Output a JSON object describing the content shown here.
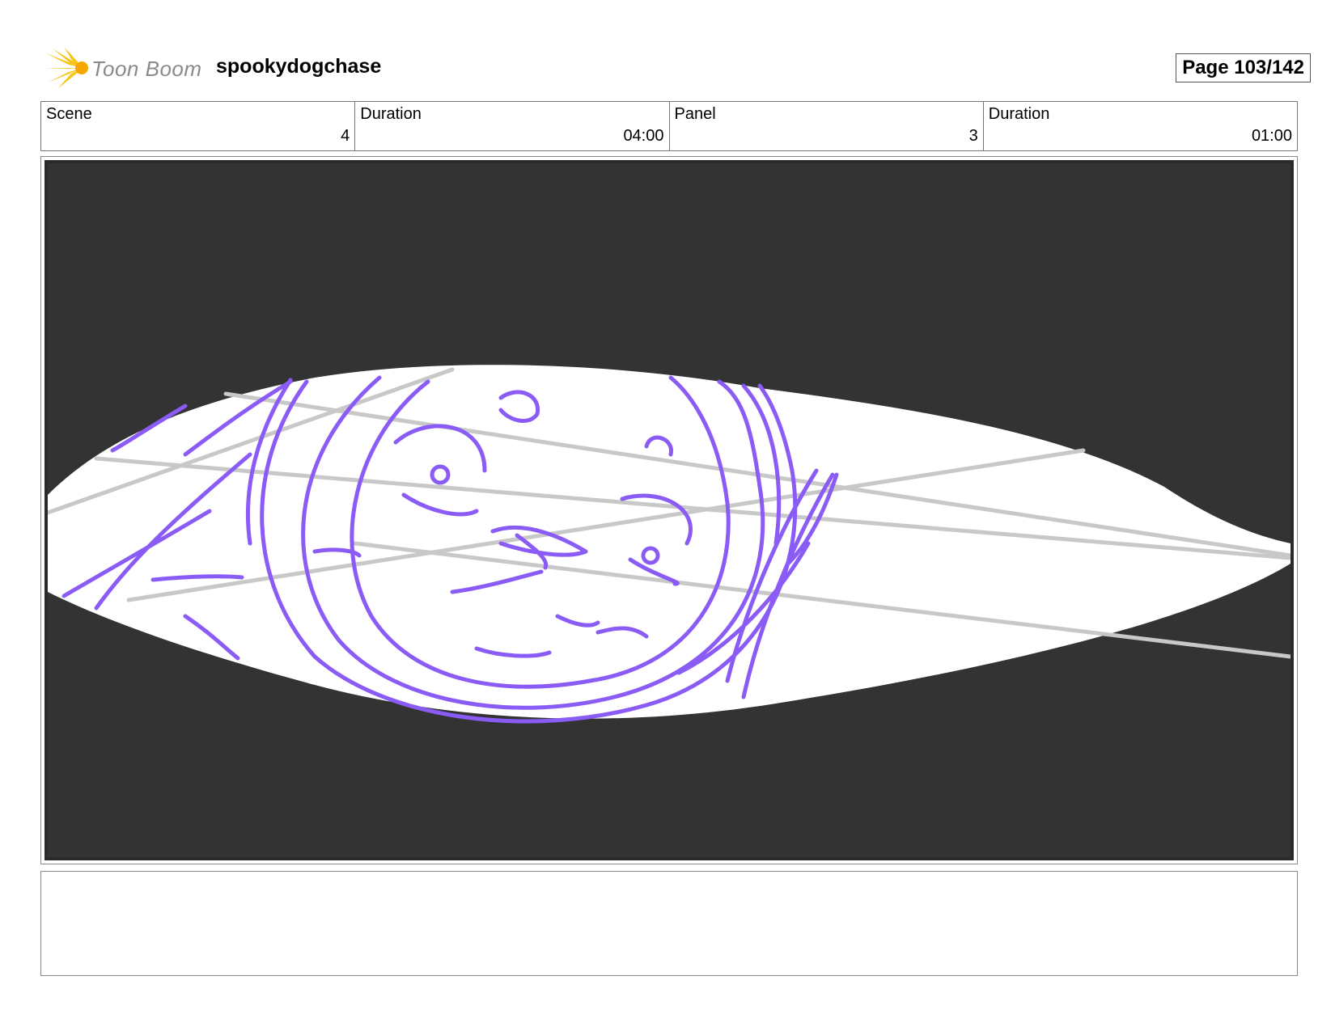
{
  "header": {
    "logo_text": "Toon Boom",
    "project_title": "spookydogchase",
    "page_label": "Page 103/142"
  },
  "info": {
    "scene_label": "Scene",
    "scene_value": "4",
    "scene_duration_label": "Duration",
    "scene_duration_value": "04:00",
    "panel_label": "Panel",
    "panel_value": "3",
    "panel_duration_label": "Duration",
    "panel_duration_value": "01:00"
  },
  "panel": {
    "sketch_color": "#8a5cf5",
    "guide_color": "#c8c8c8",
    "mask_color": "#333333"
  },
  "notes": {
    "text": ""
  }
}
